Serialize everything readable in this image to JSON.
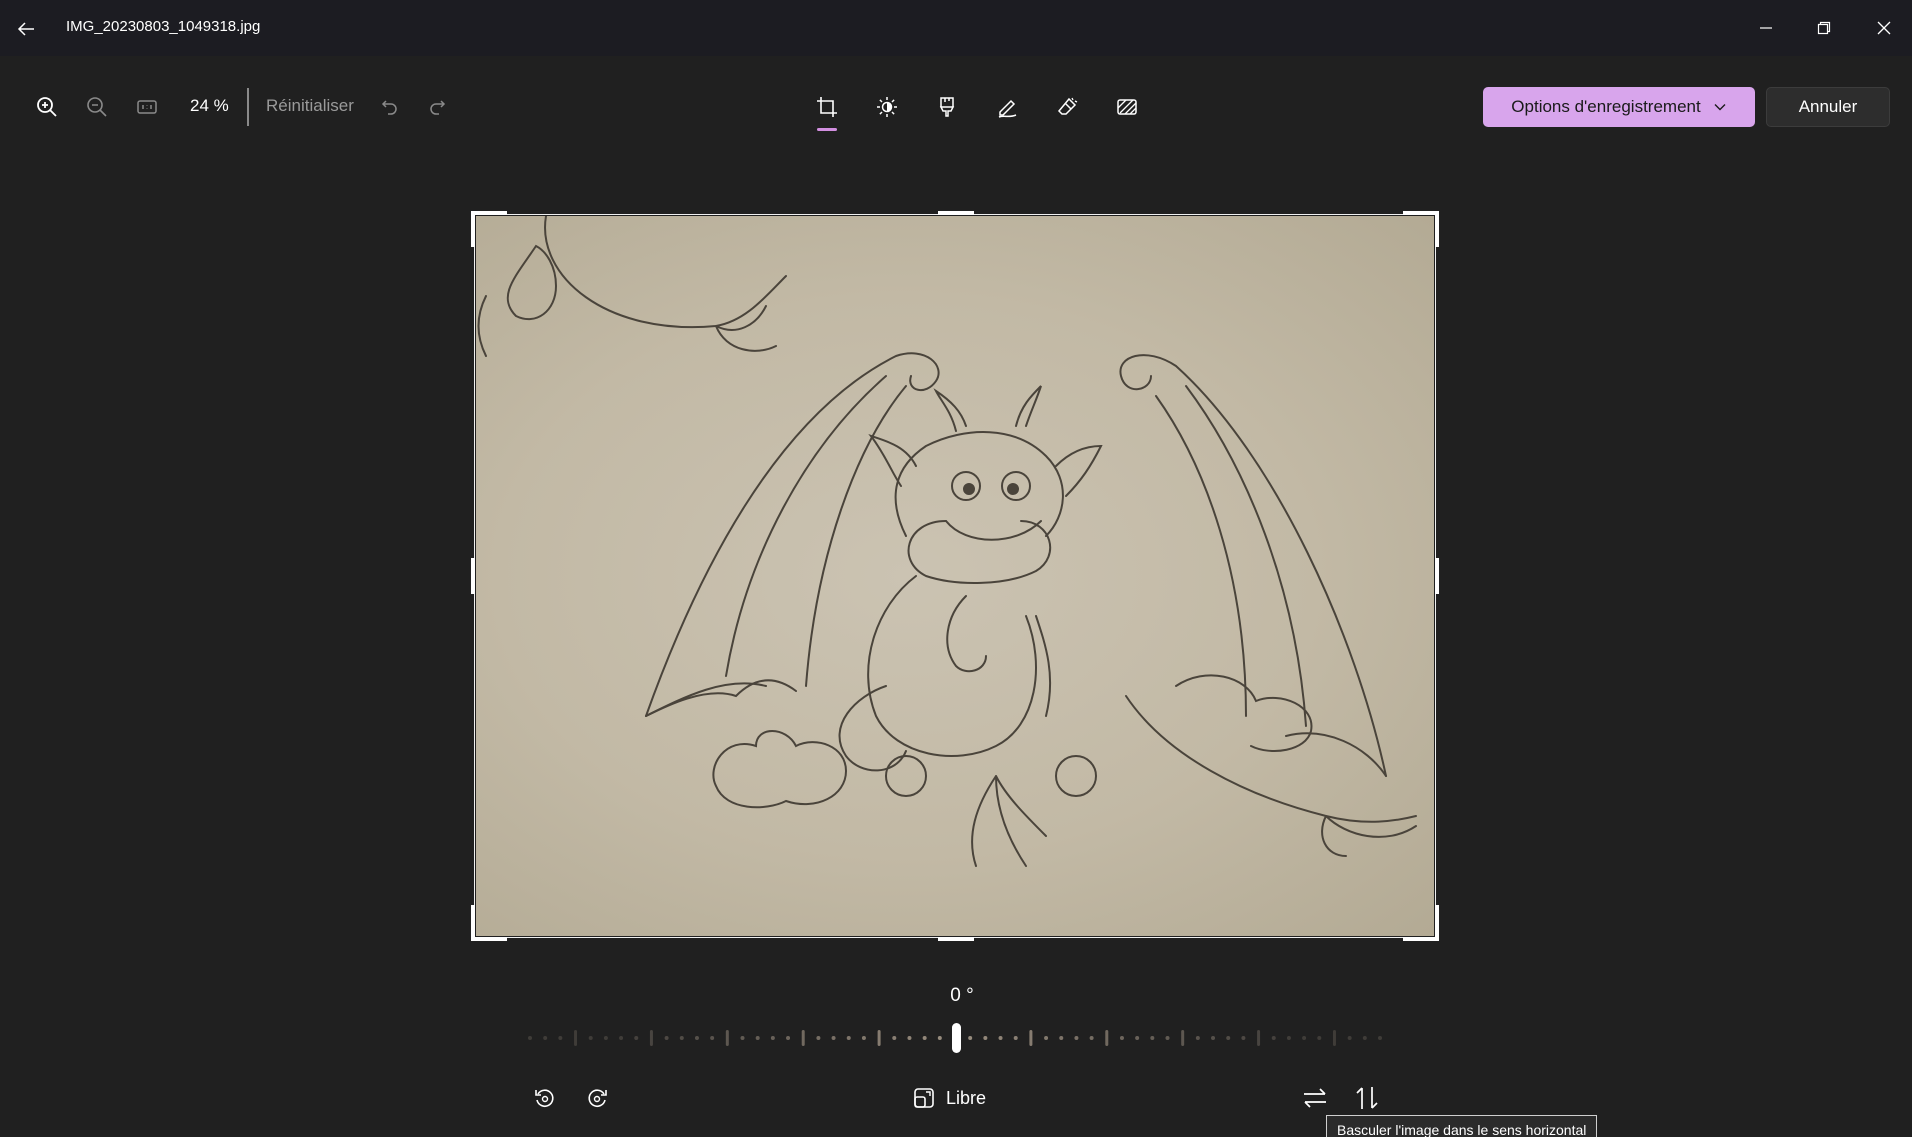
{
  "window": {
    "title": "IMG_20230803_1049318.jpg"
  },
  "toolbar": {
    "zoom_percent": "24 %",
    "reset_label": "Réinitialiser",
    "save_options_label": "Options d'enregistrement",
    "cancel_label": "Annuler",
    "tools": [
      "crop-icon",
      "adjust-brightness-icon",
      "filter-icon",
      "markup-pen-icon",
      "erase-icon",
      "background-blur-icon"
    ],
    "active_tool": "crop-icon"
  },
  "editor": {
    "rotation_label": "0 °",
    "rotation_degrees": 0,
    "aspect_ratio_label": "Libre",
    "tooltip": "Basculer l'image dans le sens horizontal"
  },
  "colors": {
    "accent": "#d8a5ec",
    "background": "#202020",
    "titlebar": "#1c1c22"
  }
}
